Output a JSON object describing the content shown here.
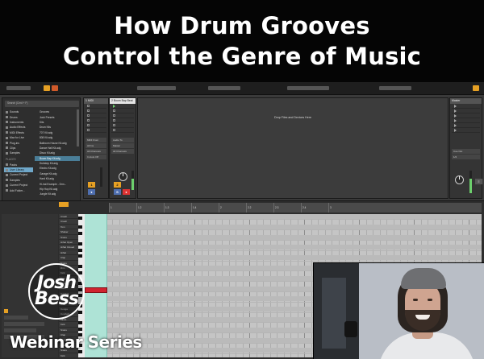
{
  "video": {
    "title_line1": "How Drum Grooves",
    "title_line2": "Control the Genre of Music"
  },
  "browser": {
    "search_placeholder": "Search (Cmd + F)",
    "categories": [
      "Sounds",
      "Drums",
      "Instruments",
      "Audio Effects",
      "MIDI Effects",
      "Max for Live",
      "Plug-ins",
      "Clips",
      "Samples"
    ],
    "places_header": "PLACES",
    "places": [
      "Packs",
      "User Library",
      "Current Project",
      "Samples",
      "Current Project",
      "Add Folder..."
    ],
    "selected_place": "User Library",
    "files": [
      "Grooves",
      "Josh Presets",
      "Kits",
      "Drum Kits",
      "707 Kit.adg",
      "808 Kit.adg",
      "Ballroom House Kit.adg",
      "Dance Hall Kit.adg",
      "Disco Kit.adg",
      "Boom Bap Kit.adg",
      "Dubstep Kit.adg",
      "Electro Kit.adg",
      "Garage Kit.adg",
      "Hard Kit.adg",
      "Hi-hat Example - Drm...",
      "Hip Hop Kit.adg",
      "Jungle Kit.adg"
    ],
    "selected_file": "Boom Bap Kit.adg"
  },
  "session": {
    "tracks": [
      {
        "name": "1 MIDI",
        "active": false
      },
      {
        "name": "2 Boom Bap Beat",
        "active": true
      }
    ],
    "io": {
      "midi_from": "MIDI From",
      "all_ins": "All Ins",
      "all_channels": "All Channels",
      "monitor": "In Auto Off",
      "audio_to": "Audio To",
      "master": "Master"
    },
    "track_numbers": [
      "1",
      "2"
    ],
    "drop_hint": "Drop Files and Devices Here",
    "master_label": "Master",
    "master_tempo_label": "Cue Out",
    "master_out": "1/2"
  },
  "clip": {
    "ruler": [
      "1",
      "1.2",
      "1.3",
      "1.4",
      "2",
      "2.2",
      "2.3",
      "2.4",
      "3"
    ],
    "lanes": [
      "Crash",
      "Crash",
      "Tom",
      "Shaker",
      "Snare",
      "Hihat Open",
      "Hihat Closed",
      "Hihat",
      "Clap",
      "Snare",
      "Rim",
      "Kick",
      "Kick",
      "Tom",
      "Bass",
      "Cymbal",
      "Perc",
      "Ride",
      "Conga",
      "Cowbell",
      "Tamb",
      "Kick",
      "Snare",
      "Clap",
      "Perc",
      "Kick",
      "Snare",
      "Kick"
    ]
  },
  "branding": {
    "logo_line1": "Josh",
    "logo_line2": "Bess",
    "series": "Webinar Series"
  },
  "colors": {
    "accent_orange": "#e6a024",
    "loop_teal": "#aee3d6",
    "note_red": "#d0242f"
  }
}
